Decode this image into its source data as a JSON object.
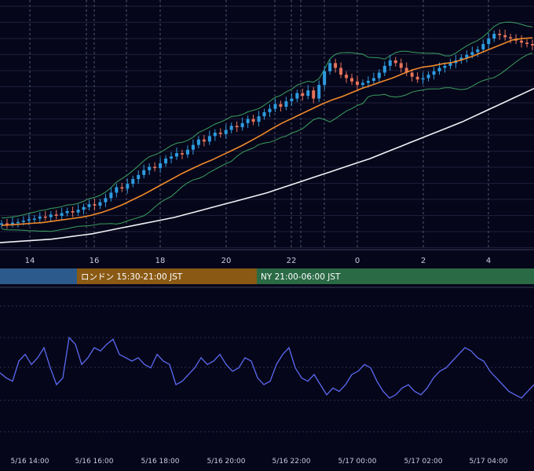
{
  "chart_data": {
    "type": "line",
    "description_free": true,
    "top_x_ticks": [
      "14",
      "16",
      "18",
      "20",
      "22",
      "0",
      "2",
      "4"
    ],
    "bottom_x_ticks": [
      "5/16 14:00",
      "5/16 16:00",
      "5/16 18:00",
      "5/16 20:00",
      "5/16 22:00",
      "5/17 00:00",
      "5/17 02:00",
      "5/17 04:00"
    ],
    "sessions": [
      {
        "label": "",
        "color": "#2c5a8c"
      },
      {
        "label": "ロンドン 15:30-21:00 JST",
        "color": "#8a5a14"
      },
      {
        "label": "NY 21:00-06:00 JST",
        "color": "#2a6a45"
      }
    ],
    "price_close": [
      0.27,
      0.26,
      0.28,
      0.29,
      0.31,
      0.33,
      0.34,
      0.37,
      0.36,
      0.4,
      0.38,
      0.42,
      0.45,
      0.43,
      0.47,
      0.51,
      0.55,
      0.53,
      0.58,
      0.64,
      0.72,
      0.8,
      0.78,
      0.85,
      0.92,
      0.98,
      1.05,
      1.1,
      1.08,
      1.15,
      1.22,
      1.25,
      1.3,
      1.28,
      1.35,
      1.42,
      1.5,
      1.47,
      1.55,
      1.6,
      1.58,
      1.64,
      1.7,
      1.68,
      1.74,
      1.8,
      1.76,
      1.84,
      1.9,
      1.95,
      2.02,
      1.98,
      2.06,
      2.1,
      2.18,
      2.14,
      2.22,
      2.1,
      2.3,
      2.5,
      2.62,
      2.55,
      2.45,
      2.4,
      2.35,
      2.3,
      2.33,
      2.36,
      2.4,
      2.48,
      2.58,
      2.66,
      2.62,
      2.55,
      2.48,
      2.42,
      2.38,
      2.4,
      2.45,
      2.5,
      2.55,
      2.58,
      2.62,
      2.66,
      2.7,
      2.74,
      2.78,
      2.82,
      2.9,
      2.98,
      3.05,
      3.03,
      3.0,
      2.98,
      2.95,
      2.92,
      2.9,
      2.88
    ],
    "ma_fast": [
      0.24,
      0.25,
      0.26,
      0.27,
      0.28,
      0.3,
      0.32,
      0.34,
      0.36,
      0.39,
      0.43,
      0.48,
      0.54,
      0.61,
      0.68,
      0.76,
      0.84,
      0.92,
      1.0,
      1.07,
      1.14,
      1.2,
      1.27,
      1.34,
      1.41,
      1.49,
      1.57,
      1.66,
      1.74,
      1.81,
      1.88,
      1.95,
      2.02,
      2.08,
      2.13,
      2.19,
      2.25,
      2.3,
      2.35,
      2.4,
      2.46,
      2.52,
      2.56,
      2.58,
      2.61,
      2.63,
      2.67,
      2.72,
      2.78,
      2.84,
      2.9,
      2.96,
      2.98,
      2.99
    ],
    "ma_slow": [
      0.08,
      0.09,
      0.1,
      0.11,
      0.12,
      0.13,
      0.15,
      0.17,
      0.19,
      0.21,
      0.24,
      0.27,
      0.3,
      0.33,
      0.36,
      0.39,
      0.42,
      0.45,
      0.49,
      0.53,
      0.57,
      0.61,
      0.65,
      0.69,
      0.73,
      0.77,
      0.81,
      0.86,
      0.91,
      0.96,
      1.01,
      1.06,
      1.11,
      1.16,
      1.21,
      1.26,
      1.31,
      1.37,
      1.43,
      1.49,
      1.55,
      1.61,
      1.67,
      1.73,
      1.79,
      1.85,
      1.92,
      1.99,
      2.06,
      2.13,
      2.2,
      2.27,
      2.34
    ],
    "oscillator": [
      55,
      52,
      50,
      62,
      66,
      60,
      64,
      70,
      58,
      48,
      52,
      76,
      72,
      60,
      64,
      70,
      68,
      72,
      75,
      66,
      64,
      62,
      64,
      60,
      58,
      66,
      62,
      60,
      48,
      50,
      54,
      58,
      64,
      60,
      62,
      66,
      60,
      56,
      58,
      64,
      62,
      52,
      48,
      50,
      60,
      66,
      70,
      58,
      52,
      50,
      54,
      48,
      42,
      46,
      44,
      48,
      54,
      56,
      60,
      58,
      50,
      44,
      40,
      42,
      46,
      48,
      44,
      42,
      46,
      52,
      56,
      58,
      62,
      66,
      70,
      68,
      64,
      62,
      56,
      52,
      48,
      44,
      42,
      40,
      44,
      48
    ],
    "grid": true
  }
}
